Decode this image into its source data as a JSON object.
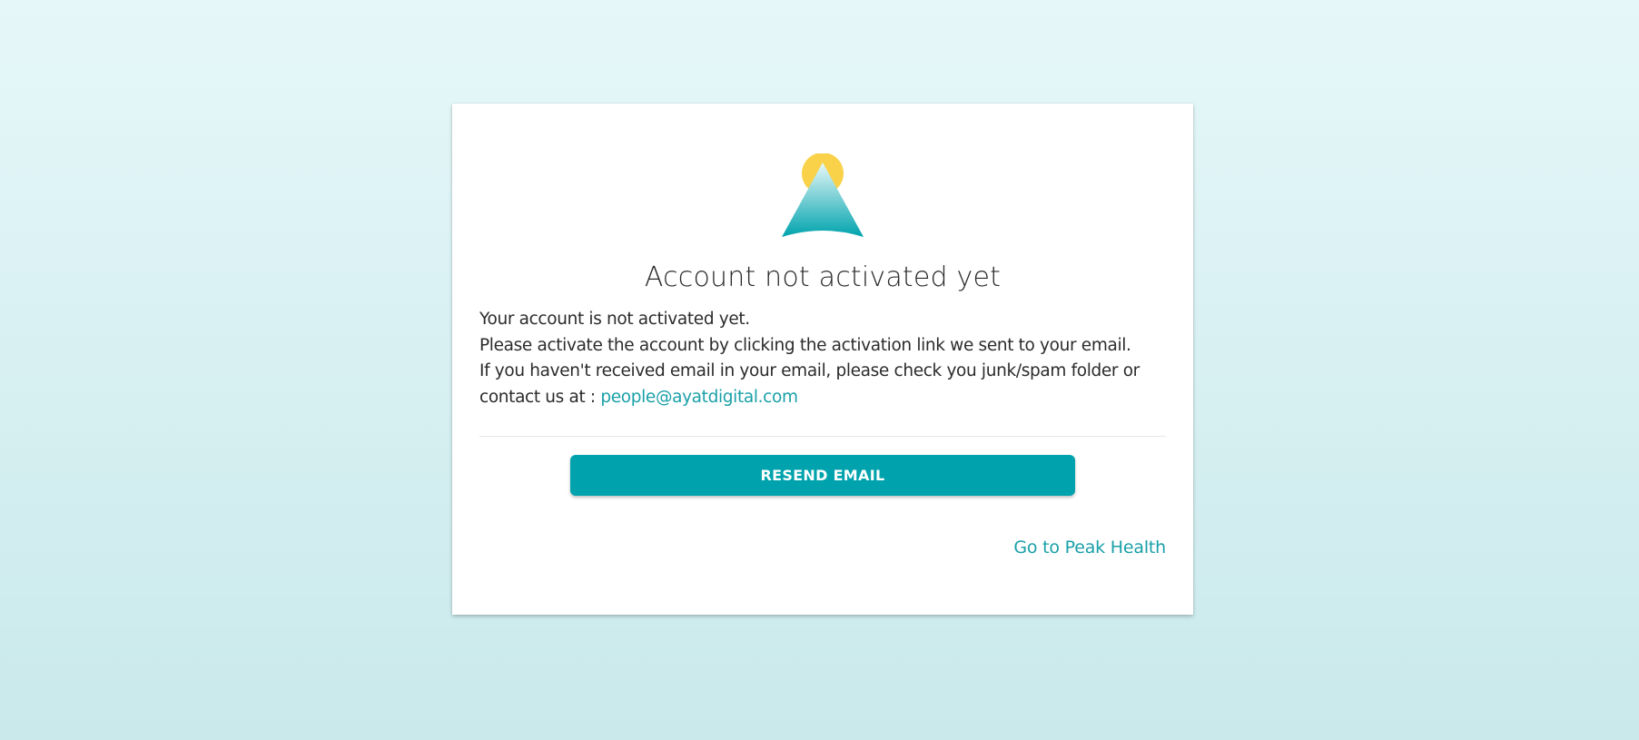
{
  "card": {
    "logo_icon": "peak-mountain-sun-logo",
    "title": "Account not activated yet",
    "message": {
      "line1": "Your account is not activated yet.",
      "line2": "Please activate the account by clicking the activation link we sent to your email.",
      "line3": "If you haven't received email in your email, please check you junk/spam folder or",
      "line4_prefix": "contact us at :",
      "contact_email": "people@ayatdigital.com"
    },
    "resend_button_label": "RESEND EMAIL",
    "go_link_label": "Go to Peak Health"
  },
  "colors": {
    "accent": "#00a3ad",
    "link": "#1aa0a8",
    "sun": "#f9d24a",
    "background_top": "#e6f7f9",
    "background_bottom": "#c9e9eb"
  }
}
